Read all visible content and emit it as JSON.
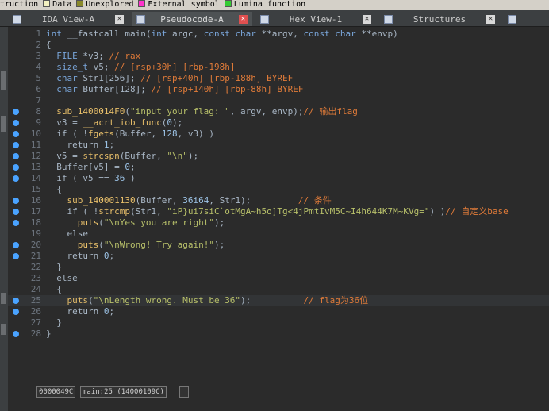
{
  "legend": [
    {
      "label": "truction",
      "color": "#6b8fc9"
    },
    {
      "label": "Data",
      "color": "#f2f0c0"
    },
    {
      "label": "Unexplored",
      "color": "#8a8a2a"
    },
    {
      "label": "External symbol",
      "color": "#ff33cc"
    },
    {
      "label": "Lumina function",
      "color": "#33cc33"
    }
  ],
  "tabs": [
    {
      "label": "IDA View-A",
      "active": false
    },
    {
      "label": "Pseudocode-A",
      "active": true
    },
    {
      "label": "Hex View-1",
      "active": false
    },
    {
      "label": "Structures",
      "active": false
    }
  ],
  "editor": {
    "lines": [
      {
        "n": "1",
        "dot": false,
        "segs": [
          [
            "t",
            "int"
          ],
          [
            "p",
            " __fastcall main("
          ],
          [
            "t",
            "int"
          ],
          [
            "p",
            " argc, "
          ],
          [
            "t",
            "const char"
          ],
          [
            "p",
            " **argv, "
          ],
          [
            "t",
            "const char"
          ],
          [
            "p",
            " **envp)"
          ]
        ]
      },
      {
        "n": "2",
        "dot": false,
        "segs": [
          [
            "p",
            "{"
          ]
        ]
      },
      {
        "n": "3",
        "dot": false,
        "segs": [
          [
            "p",
            "  "
          ],
          [
            "t",
            "FILE"
          ],
          [
            "p",
            " *v3; "
          ],
          [
            "c",
            "// rax"
          ]
        ]
      },
      {
        "n": "4",
        "dot": false,
        "segs": [
          [
            "p",
            "  "
          ],
          [
            "t",
            "size_t"
          ],
          [
            "p",
            " v5; "
          ],
          [
            "c",
            "// [rsp+30h] [rbp-198h]"
          ]
        ]
      },
      {
        "n": "5",
        "dot": false,
        "segs": [
          [
            "p",
            "  "
          ],
          [
            "t",
            "char"
          ],
          [
            "p",
            " Str1[256]; "
          ],
          [
            "c",
            "// [rsp+40h] [rbp-188h] BYREF"
          ]
        ]
      },
      {
        "n": "6",
        "dot": false,
        "segs": [
          [
            "p",
            "  "
          ],
          [
            "t",
            "char"
          ],
          [
            "p",
            " Buffer[128]; "
          ],
          [
            "c",
            "// [rsp+140h] [rbp-88h] BYREF"
          ]
        ]
      },
      {
        "n": "7",
        "dot": false,
        "segs": []
      },
      {
        "n": "8",
        "dot": true,
        "segs": [
          [
            "p",
            "  "
          ],
          [
            "f",
            "sub_1400014F0"
          ],
          [
            "p",
            "("
          ],
          [
            "s",
            "\"input your flag: \""
          ],
          [
            "p",
            ", argv, envp);"
          ],
          [
            "k",
            "// 输出flag"
          ]
        ]
      },
      {
        "n": "9",
        "dot": true,
        "segs": [
          [
            "p",
            "  v3 = "
          ],
          [
            "f",
            "__acrt_iob_func"
          ],
          [
            "p",
            "("
          ],
          [
            "n",
            "0"
          ],
          [
            "p",
            ");"
          ]
        ]
      },
      {
        "n": "10",
        "dot": true,
        "segs": [
          [
            "p",
            "  if ( !"
          ],
          [
            "f",
            "fgets"
          ],
          [
            "p",
            "(Buffer, "
          ],
          [
            "n",
            "128"
          ],
          [
            "p",
            ", v3) )"
          ]
        ]
      },
      {
        "n": "11",
        "dot": true,
        "segs": [
          [
            "p",
            "    return "
          ],
          [
            "n",
            "1"
          ],
          [
            "p",
            ";"
          ]
        ]
      },
      {
        "n": "12",
        "dot": true,
        "segs": [
          [
            "p",
            "  v5 = "
          ],
          [
            "f",
            "strcspn"
          ],
          [
            "p",
            "(Buffer, "
          ],
          [
            "s",
            "\"\\n\""
          ],
          [
            "p",
            ");"
          ]
        ]
      },
      {
        "n": "13",
        "dot": true,
        "segs": [
          [
            "p",
            "  Buffer[v5] = "
          ],
          [
            "n",
            "0"
          ],
          [
            "p",
            ";"
          ]
        ]
      },
      {
        "n": "14",
        "dot": true,
        "segs": [
          [
            "p",
            "  if ( v5 == "
          ],
          [
            "n",
            "36"
          ],
          [
            "p",
            " )"
          ]
        ]
      },
      {
        "n": "15",
        "dot": false,
        "segs": [
          [
            "p",
            "  {"
          ]
        ]
      },
      {
        "n": "16",
        "dot": true,
        "segs": [
          [
            "p",
            "    "
          ],
          [
            "f",
            "sub_140001130"
          ],
          [
            "p",
            "(Buffer, "
          ],
          [
            "n",
            "36i64"
          ],
          [
            "p",
            ", Str1);         "
          ],
          [
            "k",
            "// 条件"
          ]
        ]
      },
      {
        "n": "17",
        "dot": true,
        "segs": [
          [
            "p",
            "    if ( !"
          ],
          [
            "f",
            "strcmp"
          ],
          [
            "p",
            "(Str1, "
          ],
          [
            "s",
            "\"iP}ui7siC`otMgA~h5o]Tg<4jPmtIvM5C~I4h644K7M~KVg=\""
          ],
          [
            "p",
            ") )"
          ],
          [
            "k",
            "// 自定义base"
          ]
        ]
      },
      {
        "n": "18",
        "dot": true,
        "segs": [
          [
            "p",
            "      "
          ],
          [
            "f",
            "puts"
          ],
          [
            "p",
            "("
          ],
          [
            "s",
            "\"\\nYes you are right\""
          ],
          [
            "p",
            ");"
          ]
        ]
      },
      {
        "n": "19",
        "dot": false,
        "segs": [
          [
            "p",
            "    else"
          ]
        ]
      },
      {
        "n": "20",
        "dot": true,
        "segs": [
          [
            "p",
            "      "
          ],
          [
            "f",
            "puts"
          ],
          [
            "p",
            "("
          ],
          [
            "s",
            "\"\\nWrong! Try again!\""
          ],
          [
            "p",
            ");"
          ]
        ]
      },
      {
        "n": "21",
        "dot": true,
        "segs": [
          [
            "p",
            "    return "
          ],
          [
            "n",
            "0"
          ],
          [
            "p",
            ";"
          ]
        ]
      },
      {
        "n": "22",
        "dot": false,
        "segs": [
          [
            "p",
            "  }"
          ]
        ]
      },
      {
        "n": "23",
        "dot": false,
        "segs": [
          [
            "p",
            "  else"
          ]
        ]
      },
      {
        "n": "24",
        "dot": false,
        "segs": [
          [
            "p",
            "  {"
          ]
        ]
      },
      {
        "n": "25",
        "dot": true,
        "segs": [
          [
            "p",
            "    "
          ],
          [
            "f",
            "puts"
          ],
          [
            "p",
            "("
          ],
          [
            "s",
            "\"\\nLength wrong. Must be 36\""
          ],
          [
            "p",
            ");          "
          ],
          [
            "k",
            "// flag为36位"
          ]
        ]
      },
      {
        "n": "26",
        "dot": true,
        "segs": [
          [
            "p",
            "    return "
          ],
          [
            "n",
            "0"
          ],
          [
            "p",
            ";"
          ]
        ]
      },
      {
        "n": "27",
        "dot": false,
        "segs": [
          [
            "p",
            "  }"
          ]
        ]
      },
      {
        "n": "28",
        "dot": true,
        "segs": [
          [
            "p",
            "}"
          ]
        ]
      }
    ],
    "highlight_line": "25"
  },
  "status": {
    "address": "0000049C",
    "location": "main:25 (14000109C)"
  },
  "colors": {
    "accent": "#4aa3ff",
    "close_active": "#e05050"
  }
}
